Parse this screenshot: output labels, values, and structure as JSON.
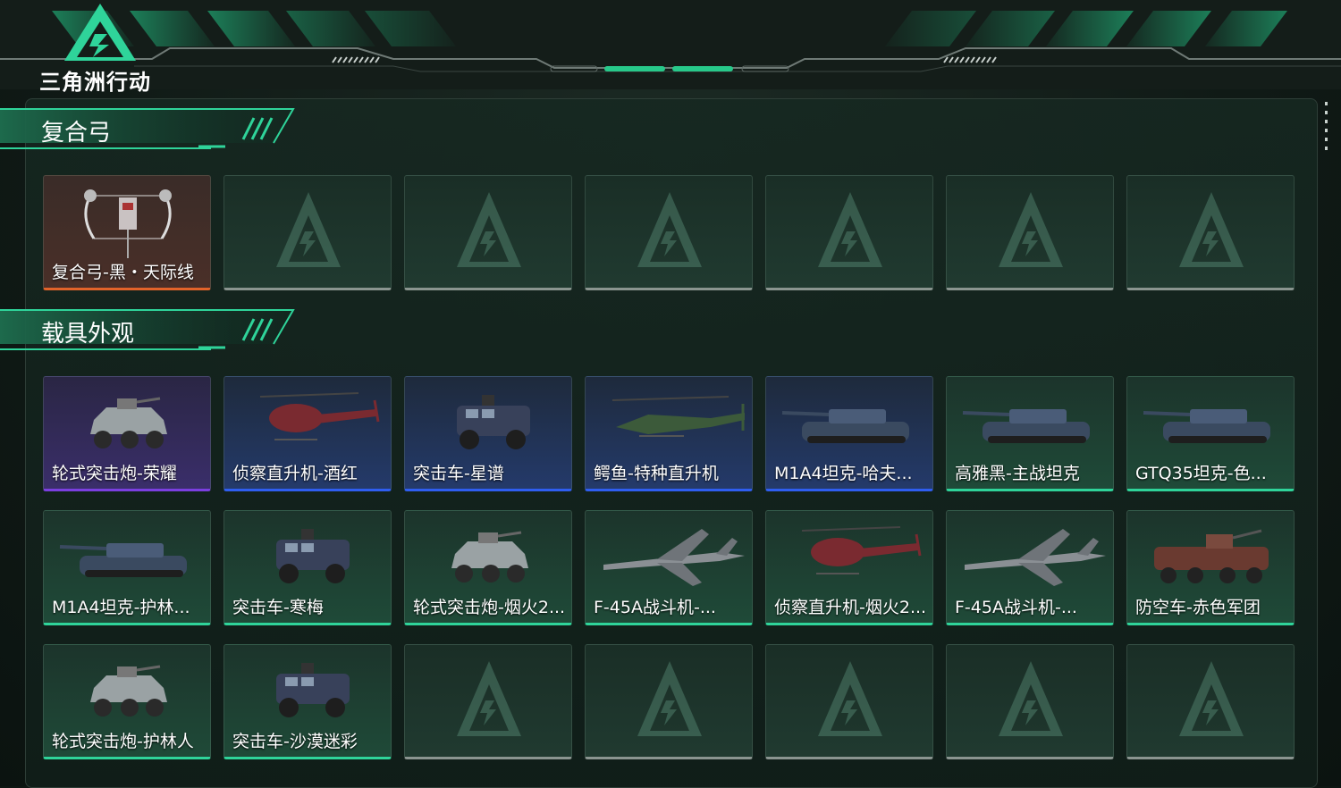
{
  "app": {
    "logo_text": "三角洲行动"
  },
  "sections": [
    {
      "title": "复合弓",
      "items": [
        {
          "label": "复合弓-黑・天际线",
          "quality": "orange",
          "icon": "compound-bow"
        },
        {
          "label": "",
          "quality": "empty"
        },
        {
          "label": "",
          "quality": "empty"
        },
        {
          "label": "",
          "quality": "empty"
        },
        {
          "label": "",
          "quality": "empty"
        },
        {
          "label": "",
          "quality": "empty"
        },
        {
          "label": "",
          "quality": "empty"
        }
      ]
    },
    {
      "title": "载具外观",
      "items": [
        {
          "label": "轮式突击炮-荣耀",
          "quality": "purple",
          "icon": "armored-car"
        },
        {
          "label": "侦察直升机-酒红",
          "quality": "blue",
          "icon": "helicopter"
        },
        {
          "label": "突击车-星谱",
          "quality": "blue",
          "icon": "assault-vehicle"
        },
        {
          "label": "鳄鱼-特种直升机",
          "quality": "blue",
          "icon": "attack-helicopter"
        },
        {
          "label": "M1A4坦克-哈夫...",
          "quality": "blue",
          "icon": "tank"
        },
        {
          "label": "高雅黑-主战坦克",
          "quality": "green",
          "icon": "tank"
        },
        {
          "label": "GTQ35坦克-色...",
          "quality": "green",
          "icon": "tank"
        },
        {
          "label": "M1A4坦克-护林...",
          "quality": "green",
          "icon": "tank"
        },
        {
          "label": "突击车-寒梅",
          "quality": "green",
          "icon": "assault-vehicle"
        },
        {
          "label": "轮式突击炮-烟火2...",
          "quality": "green",
          "icon": "armored-car"
        },
        {
          "label": "F-45A战斗机-...",
          "quality": "green",
          "icon": "fighter-jet"
        },
        {
          "label": "侦察直升机-烟火2...",
          "quality": "green",
          "icon": "helicopter"
        },
        {
          "label": "F-45A战斗机-...",
          "quality": "green",
          "icon": "fighter-jet"
        },
        {
          "label": "防空车-赤色军团",
          "quality": "green",
          "icon": "aa-vehicle"
        },
        {
          "label": "轮式突击炮-护林人",
          "quality": "green",
          "icon": "armored-car"
        },
        {
          "label": "突击车-沙漠迷彩",
          "quality": "green",
          "icon": "assault-vehicle"
        },
        {
          "label": "",
          "quality": "empty"
        },
        {
          "label": "",
          "quality": "empty"
        },
        {
          "label": "",
          "quality": "empty"
        },
        {
          "label": "",
          "quality": "empty"
        },
        {
          "label": "",
          "quality": "empty"
        }
      ]
    }
  ],
  "colors": {
    "accent": "#2fd49a",
    "orange": "#e2632a",
    "purple": "#7b3fe0",
    "blue": "#2f5ef0"
  }
}
